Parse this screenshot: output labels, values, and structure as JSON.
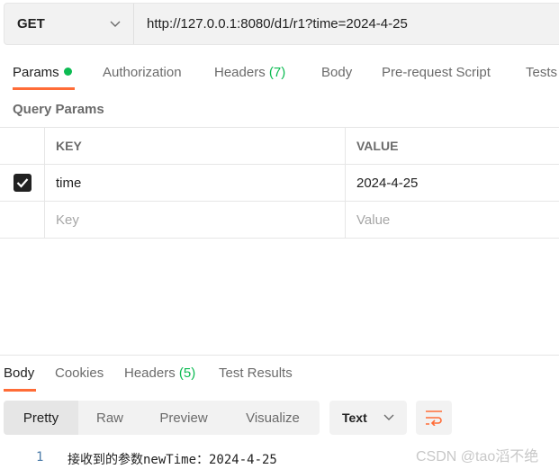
{
  "request": {
    "method": "GET",
    "url": "http://127.0.0.1:8080/d1/r1?time=2024-4-25"
  },
  "req_tabs": {
    "params": "Params",
    "authorization": "Authorization",
    "headers": "Headers",
    "headers_count": "(7)",
    "body": "Body",
    "prerequest": "Pre-request Script",
    "tests": "Tests"
  },
  "query_params": {
    "title": "Query Params",
    "key_header": "KEY",
    "value_header": "VALUE",
    "rows": [
      {
        "key": "time",
        "value": "2024-4-25",
        "checked": true
      }
    ],
    "key_placeholder": "Key",
    "value_placeholder": "Value"
  },
  "resp_tabs": {
    "body": "Body",
    "cookies": "Cookies",
    "headers": "Headers",
    "headers_count": "(5)",
    "test_results": "Test Results"
  },
  "view_modes": {
    "pretty": "Pretty",
    "raw": "Raw",
    "preview": "Preview",
    "visualize": "Visualize",
    "selected": "Pretty"
  },
  "format": "Text",
  "response_lines": [
    {
      "num": "1",
      "text": "接收到的参数newTime：2024-4-25"
    }
  ],
  "watermark": "CSDN @tao滔不绝",
  "colors": {
    "accent": "#ff6c37",
    "green": "#0cbb52"
  }
}
